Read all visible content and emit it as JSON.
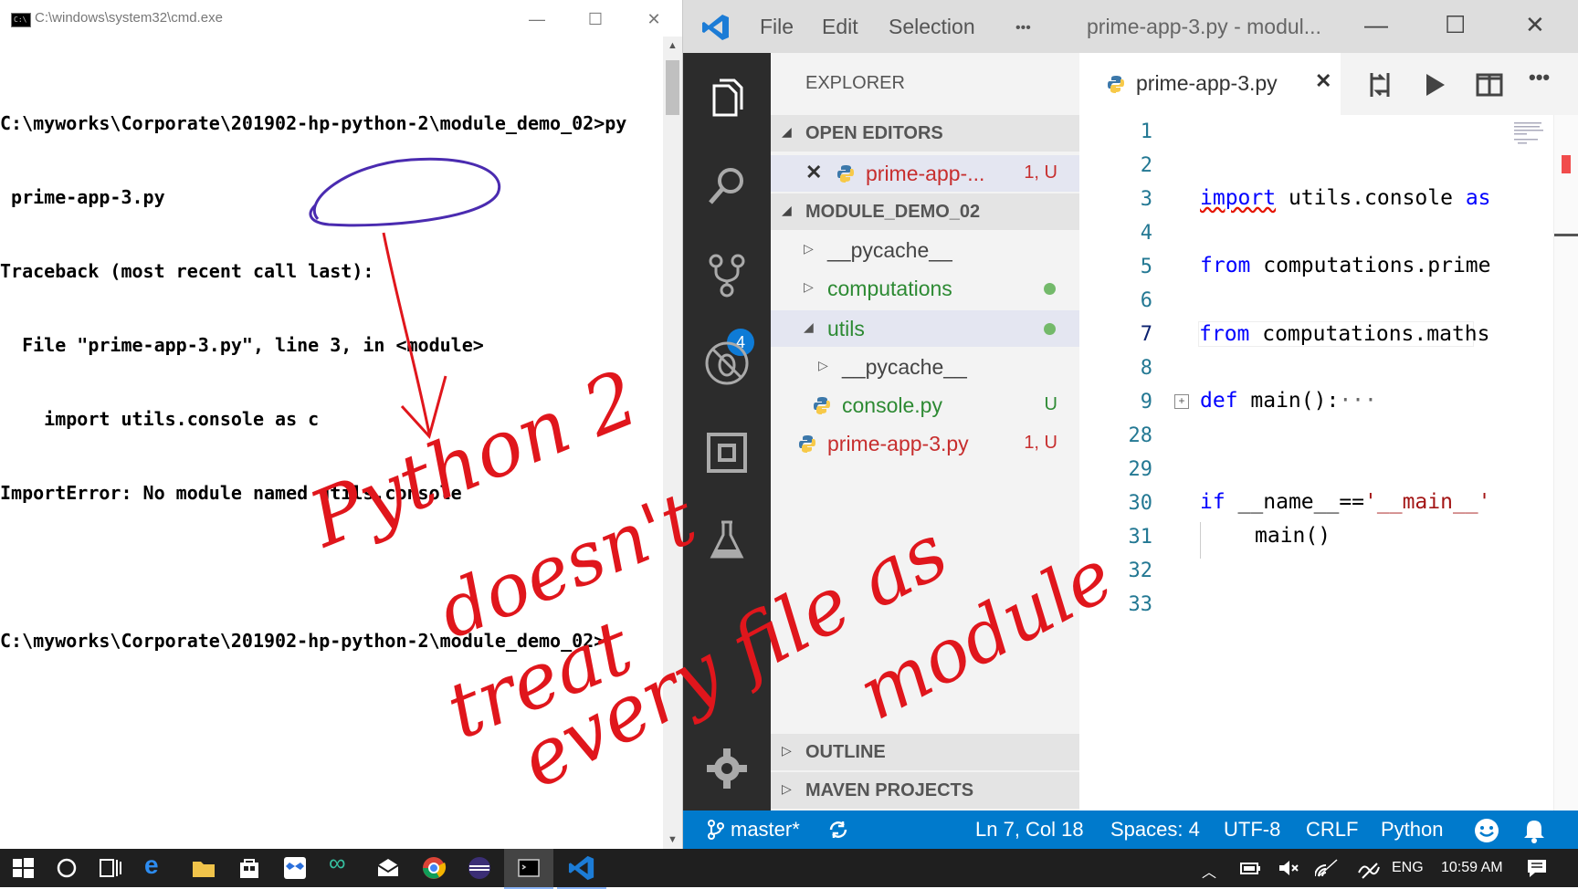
{
  "cmd": {
    "title": "C:\\windows\\system32\\cmd.exe",
    "icon": "cmd-icon",
    "lines": [
      "C:\\myworks\\Corporate\\201902-hp-python-2\\module_demo_02>py",
      " prime-app-3.py",
      "Traceback (most recent call last):",
      "  File \"prime-app-3.py\", line 3, in <module>",
      "    import utils.console as c",
      "ImportError: No module named utils.console",
      "",
      "C:\\myworks\\Corporate\\201902-hp-python-2\\module_demo_02>"
    ]
  },
  "vscode": {
    "menu": [
      "File",
      "Edit",
      "Selection",
      "•••"
    ],
    "title": "prime-app-3.py - modul...",
    "explorer_label": "EXPLORER",
    "sections": {
      "open_editors": "OPEN EDITORS",
      "project": "MODULE_DEMO_02",
      "outline": "OUTLINE",
      "maven": "MAVEN PROJECTS"
    },
    "open_editor": {
      "name": "prime-app-...",
      "status": "1, U"
    },
    "tree": [
      {
        "name": "__pycache__"
      },
      {
        "name": "computations"
      },
      {
        "name": "utils"
      },
      {
        "name": "__pycache__"
      },
      {
        "name": "console.py",
        "status": "U"
      },
      {
        "name": "prime-app-3.py",
        "status": "1, U"
      }
    ],
    "scm_badge": "4",
    "tab": {
      "name": "prime-app-3.py"
    },
    "line_numbers": [
      "1",
      "2",
      "3",
      "4",
      "5",
      "6",
      "7",
      "8",
      "9",
      "28",
      "29",
      "30",
      "31",
      "32",
      "33"
    ],
    "code": {
      "l3_kw": "import",
      "l3_rest": " utils.console ",
      "l3_as": "as",
      "l5_kw": "from",
      "l5_rest": " computations.prime",
      "l7_kw": "from",
      "l7_rest": " computations.maths",
      "l9_kw": "def",
      "l9_rest": " main():",
      "l9_fold": "···",
      "l30_kw": "if",
      "l30_rest": " __name__==",
      "l30_str": "'__main__'",
      "l31": "main()"
    },
    "status": {
      "branch": "master*",
      "position": "Ln 7, Col 18",
      "spaces": "Spaces: 4",
      "encoding": "UTF-8",
      "eol": "CRLF",
      "language": "Python"
    },
    "colors": {
      "accent": "#007acc",
      "modified": "#c72e2e",
      "untracked_folder": "#2d8a33"
    }
  },
  "taskbar": {
    "lang": "ENG",
    "time": "10:59 AM"
  },
  "annotation": {
    "color": "#e0161c",
    "lines": [
      "Python 2",
      "doesn't",
      "treat",
      "every file as",
      "module"
    ]
  }
}
